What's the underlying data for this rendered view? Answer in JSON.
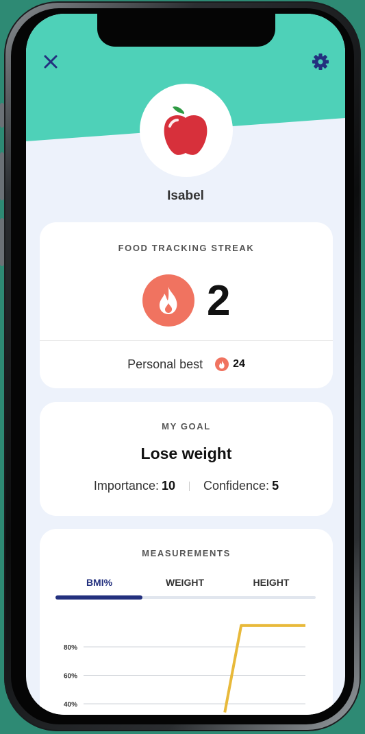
{
  "header": {
    "close_icon": "close-icon",
    "settings_icon": "gear-icon",
    "accent": "#4ed1b8"
  },
  "profile": {
    "avatar_icon": "apple-icon",
    "name": "Isabel"
  },
  "streak": {
    "label": "FOOD TRACKING STREAK",
    "count": "2",
    "personal_best_label": "Personal best",
    "personal_best_value": "24",
    "flame_color": "#f07360"
  },
  "goal": {
    "label": "MY GOAL",
    "title": "Lose weight",
    "importance_label": "Importance:",
    "importance_value": "10",
    "confidence_label": "Confidence:",
    "confidence_value": "5"
  },
  "measurements": {
    "label": "MEASUREMENTS",
    "tabs": [
      "BMI%",
      "WEIGHT",
      "HEIGHT"
    ],
    "active_tab": "BMI%",
    "active_color": "#23307e"
  },
  "chart_data": {
    "type": "line",
    "y_tick_labels": [
      "80%",
      "60%",
      "40%"
    ],
    "y_ticks": [
      80,
      60,
      40
    ],
    "line_color": "#e8b93a",
    "series": [
      {
        "points": [
          [
            0.68,
            34
          ],
          [
            0.745,
            95
          ],
          [
            0.76,
            95
          ],
          [
            1.0,
            95
          ]
        ]
      }
    ],
    "grid": true
  }
}
